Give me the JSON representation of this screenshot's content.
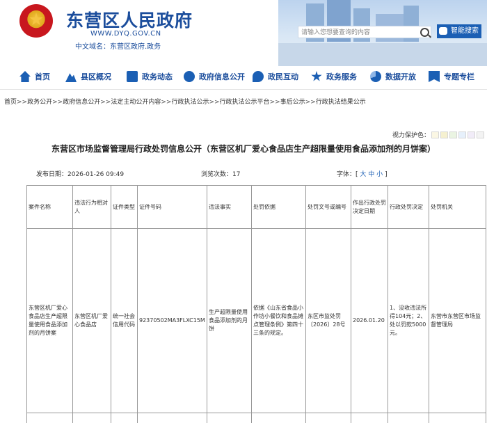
{
  "header": {
    "site_title": "东营区人民政府",
    "site_url": "WWW.DYQ.GOV.CN",
    "site_domain": "中文域名：东营区政府.政务",
    "search_placeholder": "请输入您想要查询的内容",
    "smart_search_label": "智能搜索"
  },
  "nav": {
    "items": [
      {
        "label": "首页",
        "icon": "home-icon"
      },
      {
        "label": "县区概况",
        "icon": "mountain-icon"
      },
      {
        "label": "政务动态",
        "icon": "news-icon"
      },
      {
        "label": "政府信息公开",
        "icon": "info-open-icon"
      },
      {
        "label": "政民互动",
        "icon": "chat-icon"
      },
      {
        "label": "政务服务",
        "icon": "star-icon"
      },
      {
        "label": "数据开放",
        "icon": "data-icon"
      },
      {
        "label": "专题专栏",
        "icon": "topic-icon"
      }
    ]
  },
  "breadcrumb": {
    "items": [
      "首页",
      "政务公开",
      "政府信息公开",
      "法定主动公开内容",
      "行政执法公示",
      "行政执法公示平台",
      "事后公示",
      "行政执法结果公示"
    ],
    "separator": ">>"
  },
  "view_protect": {
    "label": "视力保护色：",
    "colors": [
      "#fbf7e4",
      "#f5f0d0",
      "#eaf4e2",
      "#e6f0fb",
      "#f1ecf8",
      "#f3f3f3"
    ]
  },
  "article": {
    "title": "东营区市场监督管理局行政处罚信息公开（东营区机厂爱心食品店生产超限量使用食品添加剂的月饼案）",
    "publish_time": "发布日期：2026-01-26 09:49",
    "views": "浏览次数：17",
    "font_label": "字体：[",
    "font_large": "大",
    "font_medium": "中",
    "font_small": "小",
    "font_close": "]"
  },
  "table": {
    "headers": [
      "案件名称",
      "违法行为相对人",
      "证件类型",
      "证件号码",
      "违法事实",
      "处罚依据",
      "处罚文号或编号",
      "作出行政处罚决定日期",
      "行政处罚决定",
      "处罚机关"
    ],
    "row": [
      "东营区机厂爱心食品店生产超限量使用食品添加剂的月饼案",
      "东营区机厂爱心食品店",
      "统一社会信用代码",
      "92370502MA3FLXC15M",
      "生产超限量使用食品添加剂的月饼",
      "依据《山东省食品小作坊小餐饮和食品摊点管理条例》第四十三条的规定。",
      "东区市监处罚〔2026〕28号",
      "2026.01.20",
      "1、没收违法所得104元；2、处以罚款5000元。",
      "东营市东营区市场监督管理局"
    ]
  }
}
